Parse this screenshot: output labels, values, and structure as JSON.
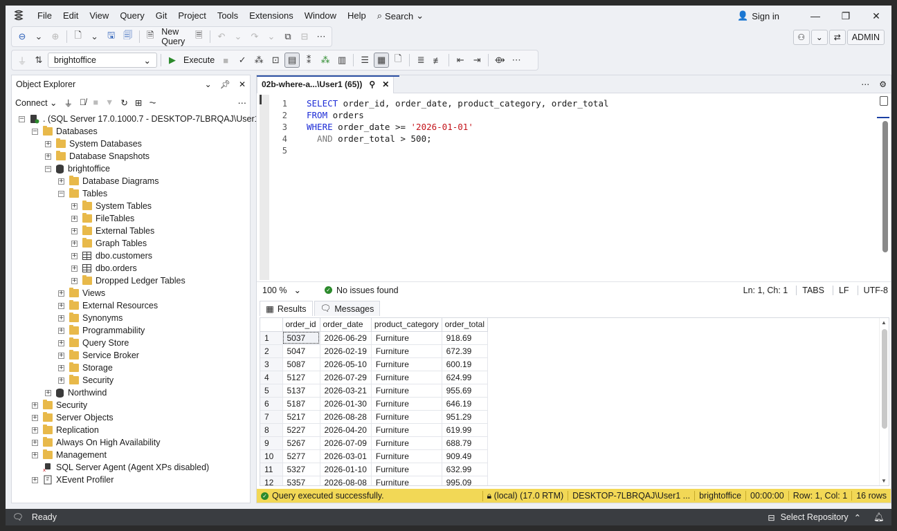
{
  "menu": [
    "File",
    "Edit",
    "View",
    "Query",
    "Git",
    "Project",
    "Tools",
    "Extensions",
    "Window",
    "Help"
  ],
  "search_label": "Search",
  "signin_label": "Sign in",
  "admin_label": "ADMIN",
  "toolbar": {
    "new_query_label": "New Query",
    "database": "brightoffice",
    "execute_label": "Execute"
  },
  "object_explorer": {
    "title": "Object Explorer",
    "connect_label": "Connect",
    "tree": [
      {
        "label": ". (SQL Server 17.0.1000.7 - DESKTOP-7LBRQAJ\\User1)",
        "depth": 0,
        "toggle": "-",
        "icon": "server"
      },
      {
        "label": "Databases",
        "depth": 1,
        "toggle": "-",
        "icon": "folder"
      },
      {
        "label": "System Databases",
        "depth": 2,
        "toggle": "+",
        "icon": "folder"
      },
      {
        "label": "Database Snapshots",
        "depth": 2,
        "toggle": "+",
        "icon": "folder"
      },
      {
        "label": "brightoffice",
        "depth": 2,
        "toggle": "-",
        "icon": "database"
      },
      {
        "label": "Database Diagrams",
        "depth": 3,
        "toggle": "+",
        "icon": "folder"
      },
      {
        "label": "Tables",
        "depth": 3,
        "toggle": "-",
        "icon": "folder"
      },
      {
        "label": "System Tables",
        "depth": 4,
        "toggle": "+",
        "icon": "folder"
      },
      {
        "label": "FileTables",
        "depth": 4,
        "toggle": "+",
        "icon": "folder"
      },
      {
        "label": "External Tables",
        "depth": 4,
        "toggle": "+",
        "icon": "folder"
      },
      {
        "label": "Graph Tables",
        "depth": 4,
        "toggle": "+",
        "icon": "folder"
      },
      {
        "label": "dbo.customers",
        "depth": 4,
        "toggle": "+",
        "icon": "table"
      },
      {
        "label": "dbo.orders",
        "depth": 4,
        "toggle": "+",
        "icon": "table"
      },
      {
        "label": "Dropped Ledger Tables",
        "depth": 4,
        "toggle": "+",
        "icon": "folder"
      },
      {
        "label": "Views",
        "depth": 3,
        "toggle": "+",
        "icon": "folder"
      },
      {
        "label": "External Resources",
        "depth": 3,
        "toggle": "+",
        "icon": "folder"
      },
      {
        "label": "Synonyms",
        "depth": 3,
        "toggle": "+",
        "icon": "folder"
      },
      {
        "label": "Programmability",
        "depth": 3,
        "toggle": "+",
        "icon": "folder"
      },
      {
        "label": "Query Store",
        "depth": 3,
        "toggle": "+",
        "icon": "folder"
      },
      {
        "label": "Service Broker",
        "depth": 3,
        "toggle": "+",
        "icon": "folder"
      },
      {
        "label": "Storage",
        "depth": 3,
        "toggle": "+",
        "icon": "folder"
      },
      {
        "label": "Security",
        "depth": 3,
        "toggle": "+",
        "icon": "folder"
      },
      {
        "label": "Northwind",
        "depth": 2,
        "toggle": "+",
        "icon": "database"
      },
      {
        "label": "Security",
        "depth": 1,
        "toggle": "+",
        "icon": "folder"
      },
      {
        "label": "Server Objects",
        "depth": 1,
        "toggle": "+",
        "icon": "folder"
      },
      {
        "label": "Replication",
        "depth": 1,
        "toggle": "+",
        "icon": "folder"
      },
      {
        "label": "Always On High Availability",
        "depth": 1,
        "toggle": "+",
        "icon": "folder"
      },
      {
        "label": "Management",
        "depth": 1,
        "toggle": "+",
        "icon": "folder"
      },
      {
        "label": "SQL Server Agent (Agent XPs disabled)",
        "depth": 1,
        "toggle": "",
        "icon": "agent"
      },
      {
        "label": "XEvent Profiler",
        "depth": 1,
        "toggle": "+",
        "icon": "profiler"
      }
    ]
  },
  "editor": {
    "tab_title": "02b-where-a...\\User1 (65))",
    "line_numbers": [
      "1",
      "2",
      "3",
      "4",
      "5"
    ],
    "code": {
      "l1_kw": "SELECT",
      "l1_rest": " order_id, order_date, product_category, order_total",
      "l2_kw": "FROM",
      "l2_rest": " orders",
      "l3_kw": "WHERE",
      "l3_mid": " order_date >= ",
      "l3_str": "'2026-01-01'",
      "l4_kw": "  AND",
      "l4_rest": " order_total > 500;"
    },
    "zoom": "100 %",
    "issues": "No issues found",
    "position": "Ln: 1, Ch: 1",
    "indent": "TABS",
    "eol": "LF",
    "encoding": "UTF-8"
  },
  "results": {
    "tabs": [
      "Results",
      "Messages"
    ],
    "columns": [
      "order_id",
      "order_date",
      "product_category",
      "order_total"
    ],
    "rows": [
      [
        "1",
        "5037",
        "2026-06-29",
        "Furniture",
        "918.69"
      ],
      [
        "2",
        "5047",
        "2026-02-19",
        "Furniture",
        "672.39"
      ],
      [
        "3",
        "5087",
        "2026-05-10",
        "Furniture",
        "600.19"
      ],
      [
        "4",
        "5127",
        "2026-07-29",
        "Furniture",
        "624.99"
      ],
      [
        "5",
        "5137",
        "2026-03-21",
        "Furniture",
        "955.69"
      ],
      [
        "6",
        "5187",
        "2026-01-30",
        "Furniture",
        "646.19"
      ],
      [
        "7",
        "5217",
        "2026-08-28",
        "Furniture",
        "951.29"
      ],
      [
        "8",
        "5227",
        "2026-04-20",
        "Furniture",
        "619.99"
      ],
      [
        "9",
        "5267",
        "2026-07-09",
        "Furniture",
        "688.79"
      ],
      [
        "10",
        "5277",
        "2026-03-01",
        "Furniture",
        "909.49"
      ],
      [
        "11",
        "5327",
        "2026-01-10",
        "Furniture",
        "632.99"
      ],
      [
        "12",
        "5357",
        "2026-08-08",
        "Furniture",
        "995.09"
      ]
    ]
  },
  "query_status": {
    "message": "Query executed successfully.",
    "server": "(local) (17.0 RTM)",
    "user": "DESKTOP-7LBRQAJ\\User1 ...",
    "database": "brightoffice",
    "elapsed": "00:00:00",
    "cursor": "Row: 1, Col: 1",
    "row_count": "16 rows"
  },
  "statusbar": {
    "ready": "Ready",
    "repo": "Select Repository"
  }
}
